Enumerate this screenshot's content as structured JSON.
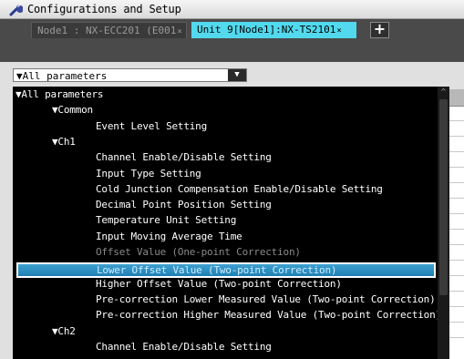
{
  "window": {
    "title": "Configurations and Setup"
  },
  "tabs": [
    {
      "label": "Node1 : NX-ECC201 (E001",
      "close": "×",
      "active": false
    },
    {
      "label": "Unit 9[Node1]:NX-TS2101",
      "close": "×",
      "active": true
    }
  ],
  "add_tab_label": "+",
  "filter": {
    "value": "▼All parameters",
    "button": "▼"
  },
  "scroll_up": "^",
  "background_marks": [
    "]",
    "]"
  ],
  "list": {
    "items": [
      {
        "label": "▼All parameters",
        "level": 0
      },
      {
        "label": "▼Common",
        "level": 1
      },
      {
        "label": "Event Level Setting",
        "level": 2
      },
      {
        "label": "▼Ch1",
        "level": 1
      },
      {
        "label": "Channel Enable/Disable Setting",
        "level": 2
      },
      {
        "label": "Input Type Setting",
        "level": 2
      },
      {
        "label": "Cold Junction Compensation Enable/Disable Setting",
        "level": 2
      },
      {
        "label": "Decimal Point Position Setting",
        "level": 2
      },
      {
        "label": "Temperature Unit Setting",
        "level": 2
      },
      {
        "label": "Input Moving Average Time",
        "level": 2
      },
      {
        "label": "Offset Value (One-point Correction)",
        "level": 2,
        "dim": true
      },
      {
        "label": "Lower Offset Value (Two-point Correction)",
        "level": 2,
        "selected": true
      },
      {
        "label": "Higher Offset Value (Two-point Correction)",
        "level": 2
      },
      {
        "label": "Pre-correction Lower Measured Value (Two-point Correction)",
        "level": 2
      },
      {
        "label": "Pre-correction Higher Measured Value (Two-point Correction)",
        "level": 2
      },
      {
        "label": "▼Ch2",
        "level": 1
      },
      {
        "label": "Channel Enable/Disable Setting",
        "level": 2
      }
    ]
  }
}
